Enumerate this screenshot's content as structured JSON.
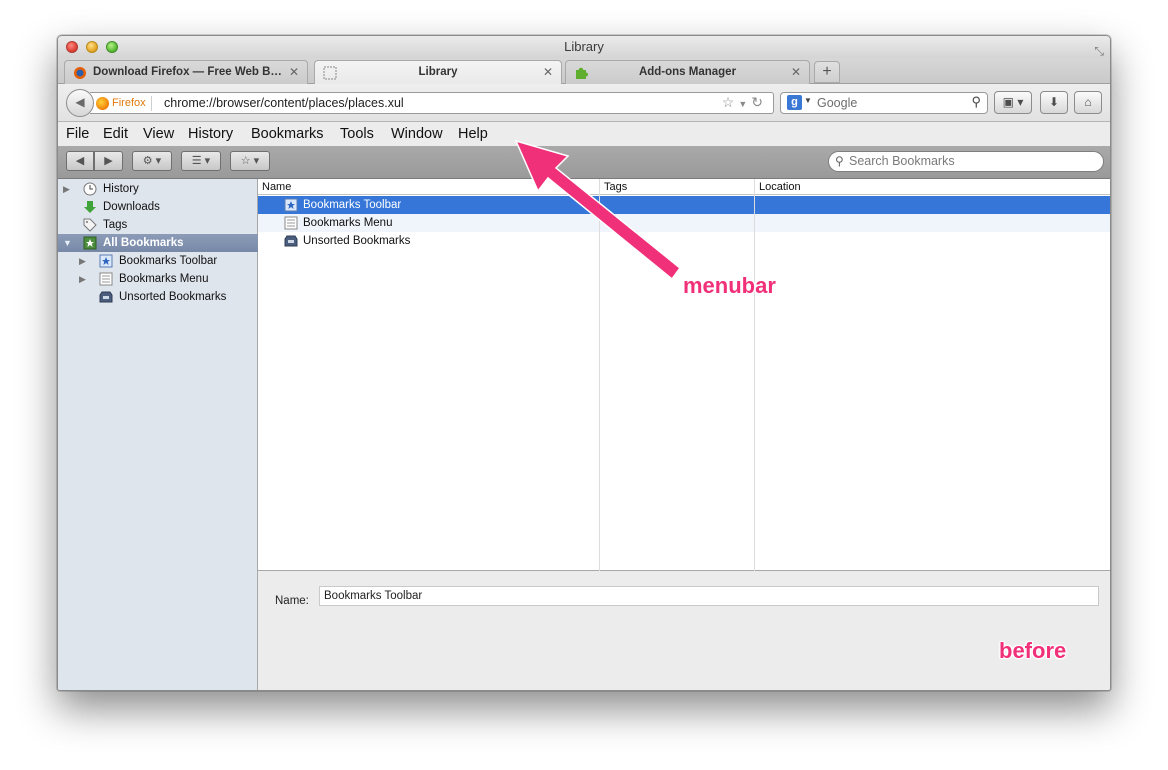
{
  "window": {
    "title": "Library"
  },
  "tabs": [
    {
      "label": "Download Firefox — Free Web B…",
      "icon": "firefox-icon"
    },
    {
      "label": "Library",
      "icon": "library-icon",
      "active": true
    },
    {
      "label": "Add-ons Manager",
      "icon": "puzzle-icon"
    }
  ],
  "navbar": {
    "identity": "Firefox",
    "url": "chrome://browser/content/places/places.xul",
    "search_placeholder": "Google",
    "search_engine": "g"
  },
  "menubar": [
    "File",
    "Edit",
    "View",
    "History",
    "Bookmarks",
    "Tools",
    "Window",
    "Help"
  ],
  "library_toolbar": {
    "search_placeholder": "Search Bookmarks"
  },
  "sidebar": {
    "items": [
      {
        "label": "History",
        "icon": "clock-icon",
        "twisty": true
      },
      {
        "label": "Downloads",
        "icon": "download-arrow-icon"
      },
      {
        "label": "Tags",
        "icon": "tag-icon"
      },
      {
        "label": "All Bookmarks",
        "icon": "bookmarks-star-icon",
        "selected": true,
        "twisty": true
      },
      {
        "label": "Bookmarks Toolbar",
        "icon": "bookmarks-toolbar-icon",
        "twisty": true,
        "indent": true
      },
      {
        "label": "Bookmarks Menu",
        "icon": "bookmarks-menu-icon",
        "twisty": true,
        "indent": true
      },
      {
        "label": "Unsorted Bookmarks",
        "icon": "unsorted-bookmarks-icon",
        "indent": true
      }
    ]
  },
  "content": {
    "columns": [
      "Name",
      "Tags",
      "Location"
    ],
    "rows": [
      {
        "name": "Bookmarks Toolbar",
        "selected": true
      },
      {
        "name": "Bookmarks Menu"
      },
      {
        "name": "Unsorted Bookmarks"
      }
    ]
  },
  "details": {
    "name_label": "Name:",
    "name_value": "Bookmarks Toolbar"
  },
  "annotations": {
    "menubar": "menubar",
    "before": "before"
  },
  "colors": {
    "accent_pink": "#f03078",
    "selection_blue": "#3576d8",
    "sidebar_bg": "#dfe5ed"
  }
}
